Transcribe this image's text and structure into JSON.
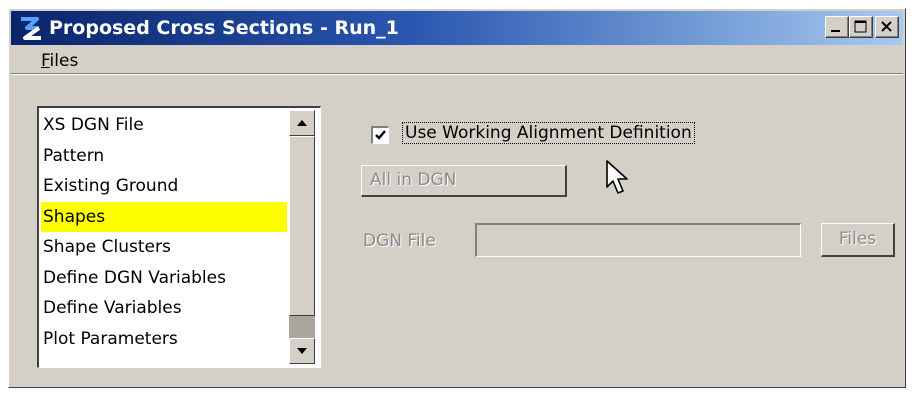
{
  "window": {
    "title": "Proposed Cross Sections - Run_1",
    "controls": {
      "minimize_icon": "minimize-icon",
      "maximize_icon": "maximize-icon",
      "close_icon": "close-icon"
    }
  },
  "menu": {
    "files": "Files"
  },
  "list": {
    "items": [
      "XS DGN File",
      "Pattern",
      "Existing Ground",
      "Shapes",
      "Shape Clusters",
      "Define DGN Variables",
      "Define Variables",
      "Plot Parameters"
    ],
    "selected": "Shapes",
    "selected_color": "#ffff00"
  },
  "options": {
    "use_working_alignment_label": "Use Working Alignment Definition",
    "use_working_alignment_checked": true,
    "all_in_dgn_label": "All in DGN",
    "dgn_file_label": "DGN File",
    "dgn_file_value": "",
    "files_button_label": "Files"
  },
  "colors": {
    "titlebar_start": "#0a246a",
    "titlebar_end": "#a6caf0",
    "face": "#d4d0c8",
    "disabled_text": "#8c8c8c"
  }
}
